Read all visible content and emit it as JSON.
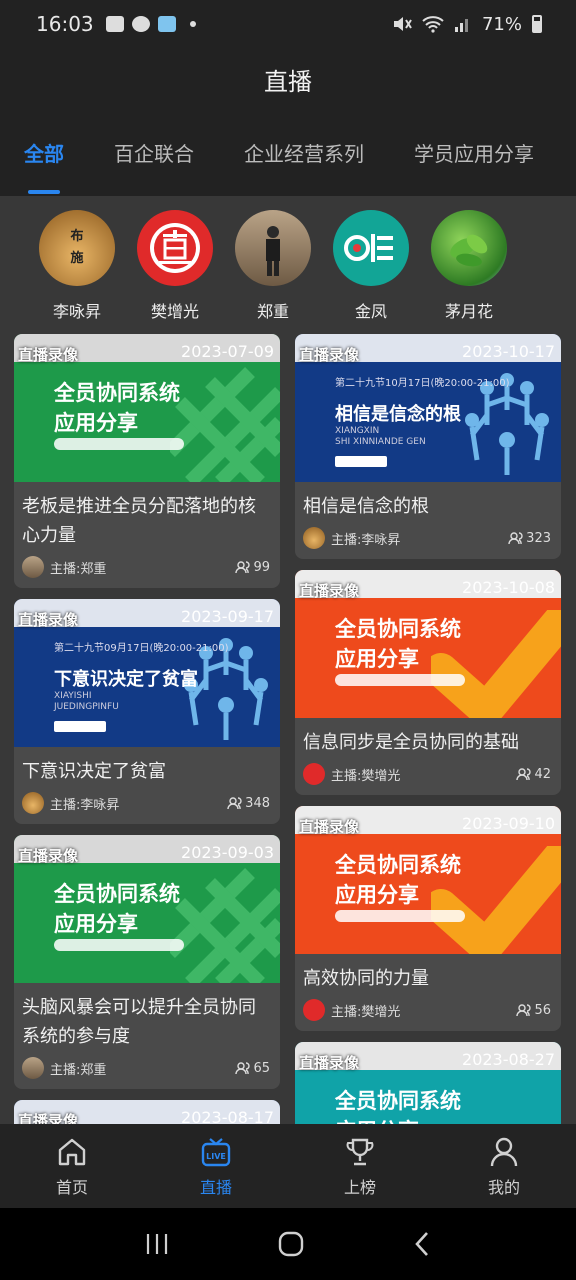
{
  "status_bar": {
    "time": "16:03",
    "battery": "71%"
  },
  "header": {
    "title": "直播"
  },
  "tabs": [
    {
      "label": "全部",
      "active": true
    },
    {
      "label": "百企联合",
      "active": false
    },
    {
      "label": "企业经营系列",
      "active": false
    },
    {
      "label": "学员应用分享",
      "active": false
    }
  ],
  "hosts": [
    {
      "name": "李咏昇",
      "avatar_text": "布\n施"
    },
    {
      "name": "樊增光",
      "avatar_text": ""
    },
    {
      "name": "郑重",
      "avatar_text": ""
    },
    {
      "name": "金凤",
      "avatar_text": ""
    },
    {
      "name": "茅月花",
      "avatar_text": ""
    }
  ],
  "cards": [
    {
      "badge": "直播录像",
      "date": "2023-07-09",
      "thumb_line1": "全员协同系统",
      "thumb_line2": "应用分享",
      "title": "老板是推进全员分配落地的核心力量",
      "host": "主播:郑重",
      "viewers": "99"
    },
    {
      "badge": "直播录像",
      "date": "2023-10-17",
      "thumb_big": "相信是信念的根",
      "thumb_small": "XIANGXIN\nSHI XINNIANDE GEN",
      "title": "相信是信念的根",
      "host": "主播:李咏昇",
      "viewers": "323"
    },
    {
      "badge": "直播录像",
      "date": "2023-09-17",
      "thumb_big": "下意识决定了贫富",
      "thumb_small": "XIAYISHI\nJUEDINGPINFU",
      "title": "下意识决定了贫富",
      "host": "主播:李咏昇",
      "viewers": "348"
    },
    {
      "badge": "直播录像",
      "date": "2023-10-08",
      "thumb_line1": "全员协同系统",
      "thumb_line2": "应用分享",
      "title": "信息同步是全员协同的基础",
      "host": "主播:樊增光",
      "viewers": "42"
    },
    {
      "badge": "直播录像",
      "date": "2023-09-03",
      "thumb_line1": "全员协同系统",
      "thumb_line2": "应用分享",
      "title": "头脑风暴会可以提升全员协同系统的参与度",
      "host": "主播:郑重",
      "viewers": "65"
    },
    {
      "badge": "直播录像",
      "date": "2023-09-10",
      "thumb_line1": "全员协同系统",
      "thumb_line2": "应用分享",
      "title": "高效协同的力量",
      "host": "主播:樊增光",
      "viewers": "56"
    },
    {
      "badge": "直播录像",
      "date": "2023-08-17"
    },
    {
      "badge": "直播录像",
      "date": "2023-08-27",
      "thumb_line1": "全员协同系统",
      "thumb_line2": "应用分享"
    }
  ],
  "bottom_nav": [
    {
      "label": "首页",
      "icon": "home-icon",
      "active": false
    },
    {
      "label": "直播",
      "icon": "live-tv-icon",
      "active": true
    },
    {
      "label": "上榜",
      "icon": "trophy-icon",
      "active": false
    },
    {
      "label": "我的",
      "icon": "person-icon",
      "active": false
    }
  ],
  "colors": {
    "accent": "#2a86f0",
    "background": "#222222",
    "content_bg": "#383838",
    "card_bg": "#4a4a4a",
    "green_thumb": "#1e9a4a",
    "blue_thumb": "#123a86",
    "orange_thumb": "#ee4a1c",
    "teal_thumb": "#10a3a8"
  }
}
